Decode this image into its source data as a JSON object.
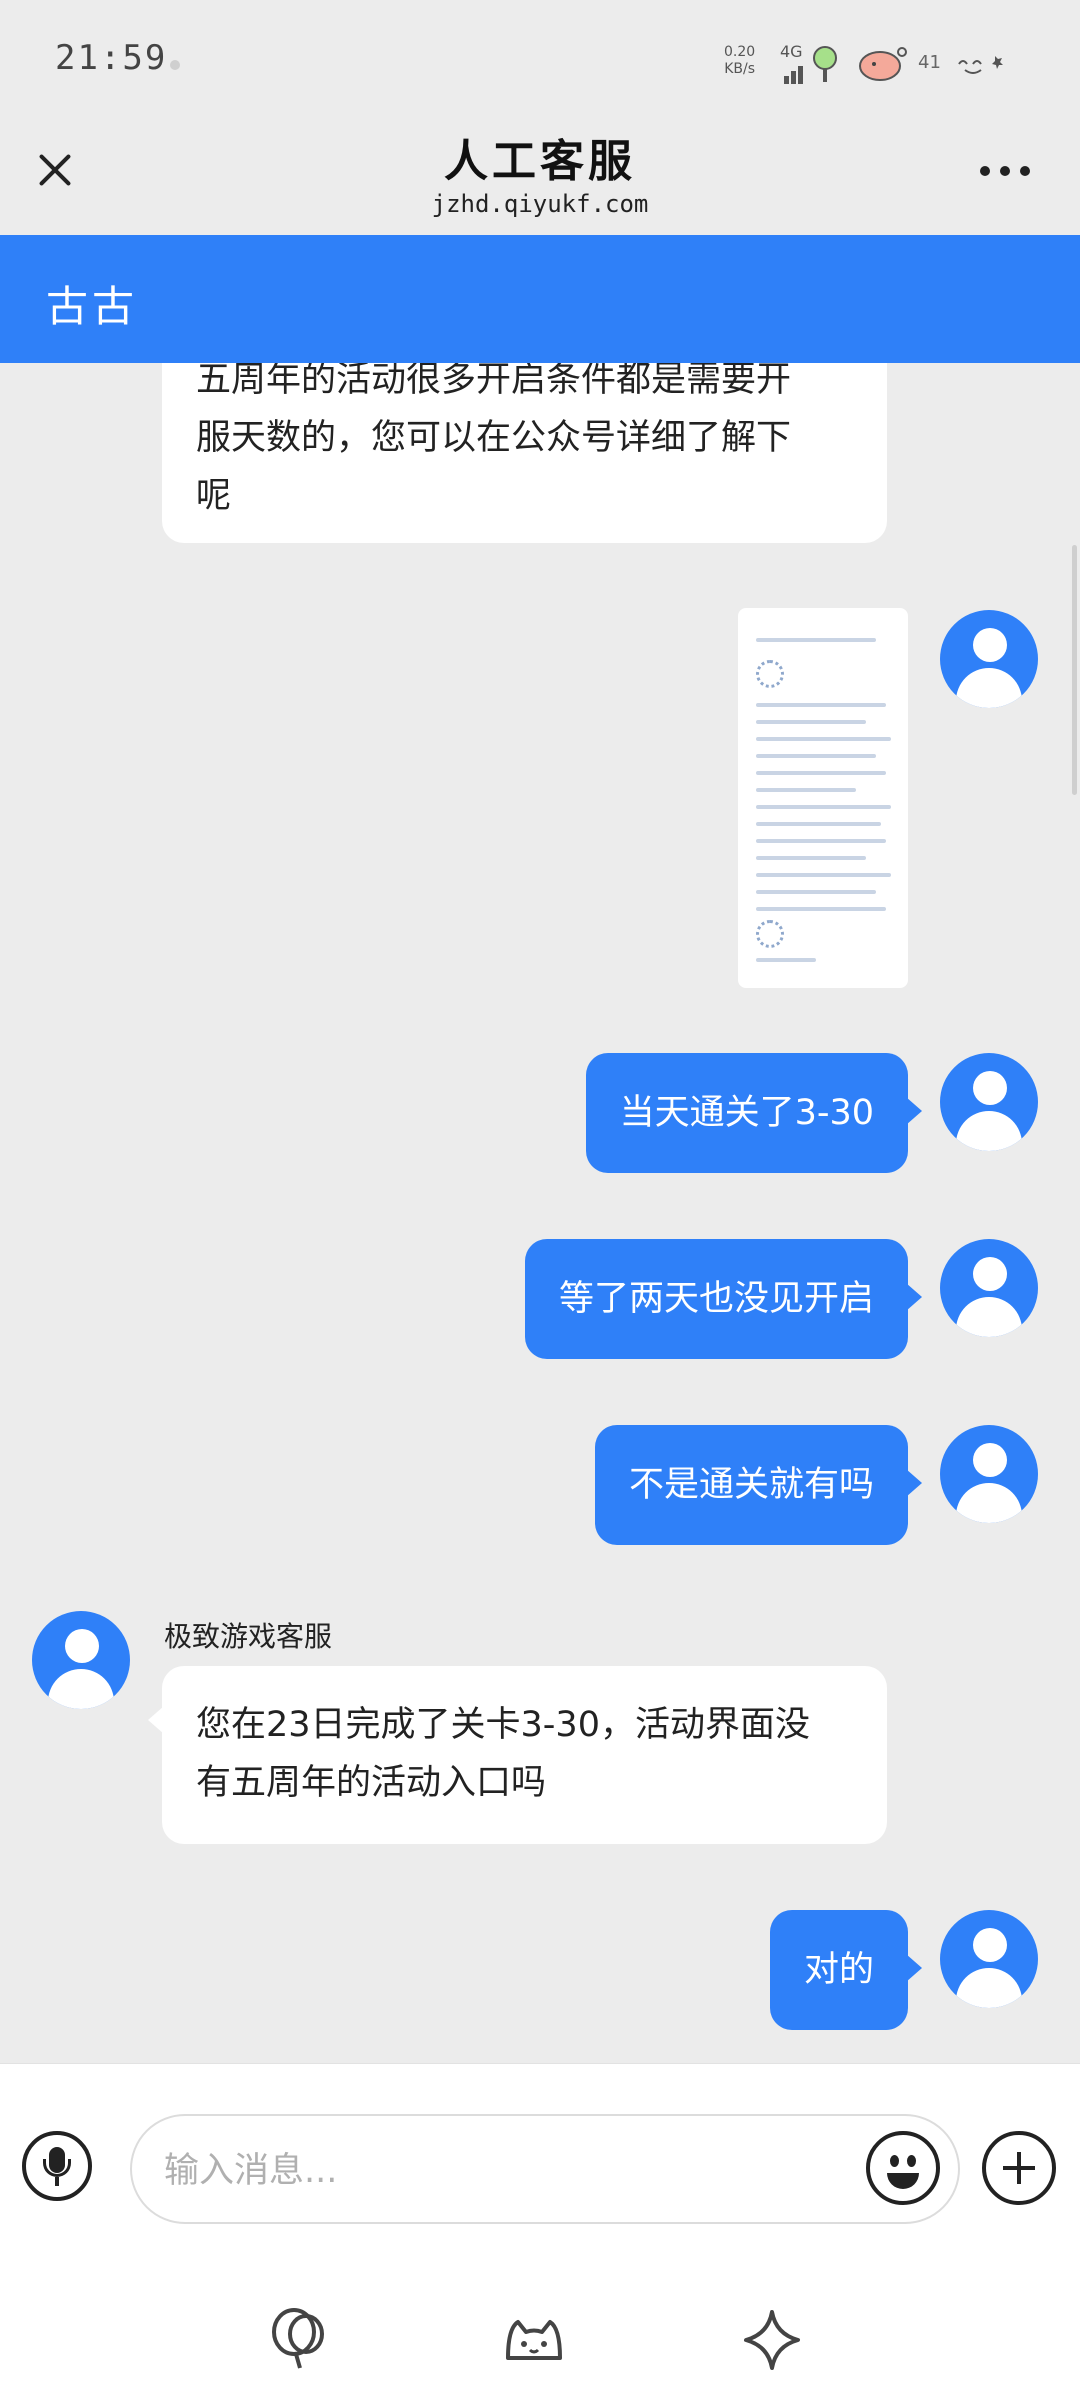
{
  "status_bar": {
    "time": "21:59",
    "net_speed_value": "0.20",
    "net_speed_unit": "KB/s",
    "network": "4G",
    "battery": "41",
    "icons": [
      "signal-icon",
      "tree-icon",
      "pig-icon",
      "face-icon"
    ]
  },
  "header": {
    "title": "人工客服",
    "subtitle": "jzhd.qiyukf.com",
    "close_icon": "close-icon",
    "more_icon": "more-icon"
  },
  "agent_bar": {
    "name": "古古",
    "color": "#2f80f8"
  },
  "messages": [
    {
      "side": "left",
      "lines": [
        "五周年的活动很多开启条件都是需要开",
        "服天数的，您可以在公众号详细了解下",
        "呢"
      ]
    },
    {
      "side": "right",
      "type": "image"
    },
    {
      "side": "right",
      "text": "当天通关了3-30"
    },
    {
      "side": "right",
      "text": "等了两天也没见开启"
    },
    {
      "side": "right",
      "text": "不是通关就有吗"
    },
    {
      "side": "left",
      "sender": "极致游戏客服",
      "lines": [
        "您在23日完成了关卡3-30，活动界面没",
        "有五周年的活动入口吗"
      ]
    },
    {
      "side": "right",
      "text": "对的"
    }
  ],
  "input_bar": {
    "placeholder": "输入消息...",
    "value": "",
    "icons": [
      "microphone-icon",
      "emoji-icon",
      "plus-icon"
    ]
  },
  "bottom_nav": {
    "icons": [
      "balloon-icon",
      "cat-face-icon",
      "sparkle-icon"
    ]
  },
  "colors": {
    "accent": "#2f80f8",
    "background": "#ececec",
    "bubble_left": "#ffffff"
  }
}
